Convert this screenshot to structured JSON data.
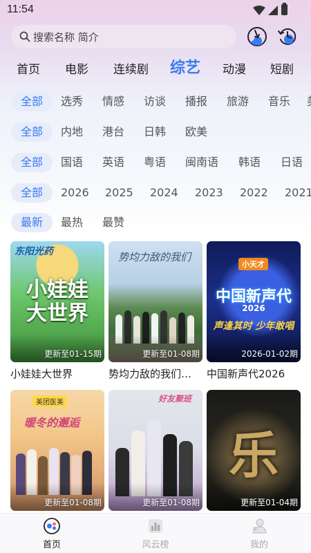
{
  "status_bar": {
    "time": "11:54"
  },
  "search": {
    "placeholder": "搜索名称 简介"
  },
  "tabs": [
    {
      "label": "首页"
    },
    {
      "label": "电影"
    },
    {
      "label": "连续剧"
    },
    {
      "label": "综艺",
      "active": true
    },
    {
      "label": "动漫"
    },
    {
      "label": "短剧"
    }
  ],
  "filters": {
    "genre": [
      "全部",
      "选秀",
      "情感",
      "访谈",
      "播报",
      "旅游",
      "音乐",
      "美"
    ],
    "region": [
      "全部",
      "内地",
      "港台",
      "日韩",
      "欧美"
    ],
    "language": [
      "全部",
      "国语",
      "英语",
      "粤语",
      "闽南语",
      "韩语",
      "日语"
    ],
    "year": [
      "全部",
      "2026",
      "2025",
      "2024",
      "2023",
      "2022",
      "2021"
    ],
    "sort": [
      "最新",
      "最热",
      "最赞"
    ]
  },
  "cards": [
    {
      "title": "小娃娃大世界",
      "badge": "更新至01-15期",
      "art_text": "小娃娃大世界",
      "art_top": "东阳光药"
    },
    {
      "title": "势均力敌的我们…",
      "badge": "更新至01-08期",
      "art_text": "势均力敌的我们"
    },
    {
      "title": "中国新声代2026",
      "badge": "2026-01-02期",
      "art_text": "中国新声代",
      "art_sub": "2026",
      "art_top": "小天才",
      "art_bottom": "声逢其时 少年敢唱"
    },
    {
      "title": "",
      "badge": "更新至01-08期",
      "art_text": "暖冬的邂逅",
      "art_top": "美团医美"
    },
    {
      "title": "",
      "badge": "更新至01-08期",
      "art_text": "好友聚班"
    },
    {
      "title": "",
      "badge": "更新至01-04期",
      "art_text": "乐"
    }
  ],
  "bottom_nav": [
    {
      "label": "首页",
      "icon": "home-game-icon",
      "active": true
    },
    {
      "label": "风云榜",
      "icon": "chart-icon"
    },
    {
      "label": "我的",
      "icon": "profile-icon"
    }
  ],
  "colors": {
    "accent": "#3a7bf0",
    "chip_bg": "#e6ecfa"
  }
}
